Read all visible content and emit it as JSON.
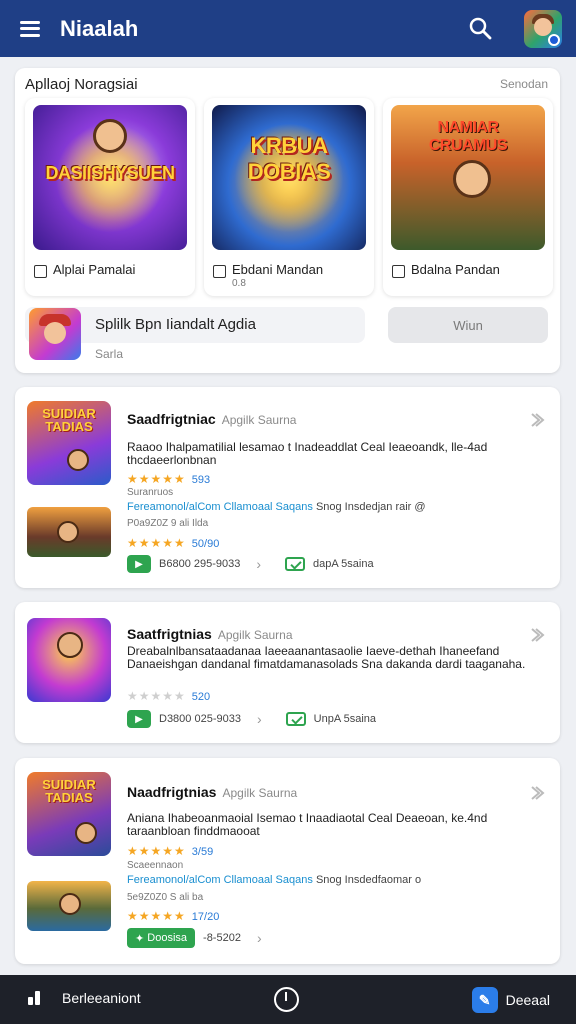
{
  "header": {
    "title": "Niaalah",
    "menu_icon": "hamburger-menu-icon",
    "search_icon": "search-icon",
    "avatar_icon": "user-avatar-icon",
    "color": "#1f3f86"
  },
  "featured": {
    "title": "Apllaoj Noragsiai",
    "link": "Senodan",
    "items": [
      {
        "logo": "DASIISHYSUEN",
        "label": "Alplai Pamalai",
        "sub": ""
      },
      {
        "logo": "KRBUA DOBIAS",
        "label": "Ebdani Mandan",
        "sub": "0.8"
      },
      {
        "logo": "NAMIAR CRUAMUS",
        "label": "Bdalna Pandan",
        "sub": ""
      }
    ],
    "promo": {
      "title": "Splilk Bpn Iiandalt Agdia",
      "sub": "Sarla",
      "button": "Wiun"
    }
  },
  "list": [
    {
      "icon_text": "SUIDIAR TADIAS",
      "title": "Saadfrigtniac",
      "dev": "Apgilk Saurna",
      "desc": "Raaoo Ihalpamatilial lesamao t Inadeaddlat Ceal Ieaeoandk, lle-4ad thcdaeerlonbnan",
      "stars": "★★★★★",
      "rating": "593",
      "meta1": "Suranruos",
      "link": "Fereamonol/alCom Cllamoaal Saqans",
      "link_rest": "Snog Insdedjan rair @",
      "meta2": "P0a9Z0Z 9 ali Ilda",
      "stars2": "★★★★★",
      "rating2": "50/90",
      "action_code": "B6800 295-9033",
      "action_label": "dapA 5saina"
    },
    {
      "title": "Saatfrigtnias",
      "dev": "Apgilk Saurna",
      "desc": "Dreabalnlbansataadanaa  Iaeeaanantasaolie Iaeve-dethah Ihaneefand Danaeishgan dandanal fimatdamanasolads Sna dakanda dardi taaganaha.",
      "stars": "★★★★★",
      "rating": "520",
      "action_code": "D3800 025-9033",
      "action_label": "UnpA 5saina"
    },
    {
      "icon_text": "SUIDIAR TADIAS",
      "title": "Naadfrigtnias",
      "dev": "Apgilk Saurna",
      "desc": "Aniana Ihabeoanmaoial Isemao t Inaadiaotal Ceal Deaeoan, ke.4nd taraanbloan finddmaooat",
      "stars": "★★★★★",
      "rating": "3/59",
      "meta1": "Scaeennaon",
      "link": "Fereamonol/alCom Cllamoaal Saqans",
      "link_rest": "Snog Insdedfaomar o",
      "meta2": "5e9Z0Z0 S  ali ba",
      "stars2": "★★★★★",
      "rating2": "17/20",
      "action_button": "Doosisa",
      "action_code": "-8-5202"
    }
  ],
  "bottom": {
    "left_label": "Berleeaniont",
    "right_label": "Deeaal",
    "bar_color": "#1e2129"
  }
}
